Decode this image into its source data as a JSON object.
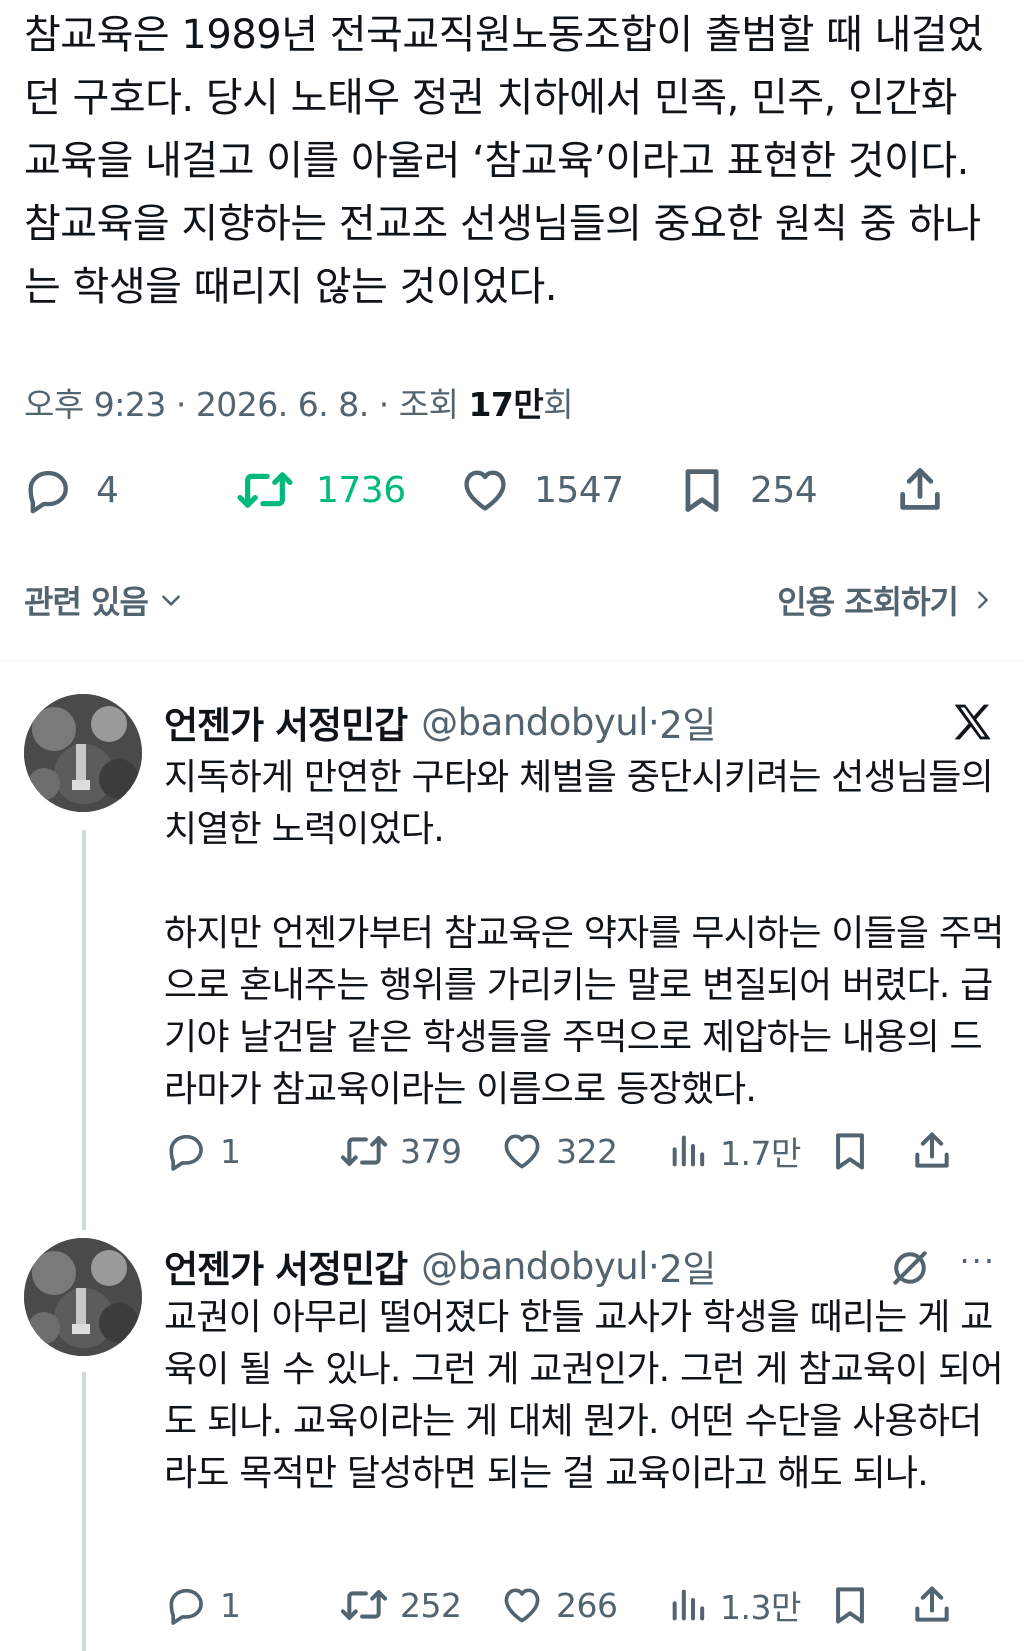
{
  "tweet": {
    "text": "참교육은 1989년 전국교직원노동조합이 출범할 때 내걸었던 구호다. 당시 노태우 정권 치하에서 민족, 민주, 인간화 교육을 내걸고 이를 아울러 ‘참교육’이라고 표현한 것이다. 참교육을 지향하는 전교조 선생님들의 중요한 원칙 중 하나는 학생을 때리지 않는 것이었다.",
    "time": "오후 9:23",
    "date": "2026. 6. 8.",
    "views_prefix": "조회",
    "views_count": "17만",
    "views_suffix": "회",
    "separator": " · ",
    "replies": "4",
    "retweets": "1736",
    "likes": "1547",
    "bookmarks": "254"
  },
  "related": {
    "left_label": "관련 있음",
    "right_label": "인용 조회하기"
  },
  "replies": [
    {
      "name": "언젠가 서정민갑",
      "handle": "@bandobyul",
      "time": "2일",
      "paragraphs": [
        "지독하게 만연한 구타와 체벌을 중단시키려는 선생님들의 치열한 노력이었다.",
        "하지만 언젠가부터 참교육은 약자를 무시하는 이들을 주먹으로 혼내주는 행위를 가리키는 말로 변질되어 버렸다. 급기야 날건달 같은 학생들을 주먹으로 제압하는 내용의 드라마가 참교육이라는 이름으로 등장했다."
      ],
      "replies": "1",
      "retweets": "379",
      "likes": "322",
      "views": "1.7만"
    },
    {
      "name": "언젠가 서정민갑",
      "handle": "@bandobyul",
      "time": "2일",
      "paragraphs": [
        "교권이 아무리 떨어졌다 한들 교사가 학생을 때리는 게 교육이 될 수 있나. 그런 게 교권인가. 그런 게 참교육이 되어도 되나. 교육이라는 게 대체 뭔가. 어떤 수단을 사용하더라도 목적만 달성하면 되는 걸 교육이라고 해도 되나."
      ],
      "replies": "1",
      "retweets": "252",
      "likes": "266",
      "views": "1.3만"
    }
  ],
  "icons": {
    "reply": "reply-icon",
    "retweet": "retweet-icon",
    "like": "heart-icon",
    "bookmark": "bookmark-icon",
    "share": "share-icon",
    "views": "views-icon",
    "x_logo": "x-logo-icon",
    "grok": "grok-icon",
    "more": "more-icon"
  },
  "colors": {
    "text": "#0f1419",
    "secondary": "#536471",
    "retweet_active": "#00ba7c",
    "thread_line": "#cfd9de"
  }
}
